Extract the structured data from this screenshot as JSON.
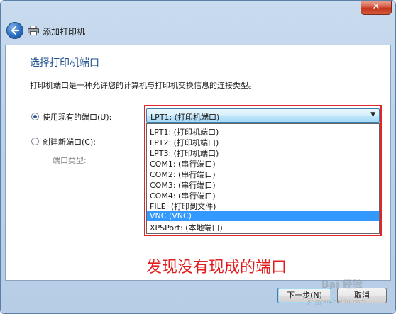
{
  "window": {
    "title": "添加打印机",
    "close_glyph": "✕"
  },
  "page": {
    "heading": "选择打印机端口",
    "description": "打印机端口是一种允许您的计算机与打印机交换信息的连接类型。"
  },
  "options": {
    "existing_label": "使用现有的端口(U):",
    "new_label": "创建新端口(C):",
    "port_type_label": "端口类型:"
  },
  "port_select": {
    "value": "LPT1: (打印机端口)",
    "items": [
      "LPT1: (打印机端口)",
      "LPT2: (打印机端口)",
      "LPT3: (打印机端口)",
      "COM1: (串行端口)",
      "COM2: (串行端口)",
      "COM3: (串行端口)",
      "COM4: (串行端口)",
      "FILE: (打印到文件)",
      "VNC (VNC)",
      "XPSPort: (本地端口)"
    ],
    "highlighted_item": "VNC (VNC)"
  },
  "annotation": {
    "text": "发现没有现成的端口",
    "color": "#e02020"
  },
  "buttons": {
    "next": "下一步(N)",
    "cancel": "取消"
  },
  "watermark": {
    "main": "Bai 经验",
    "sub": "jingyan.baidu.com"
  },
  "colors": {
    "heading": "#1e4f8d",
    "highlight": "#3399ff",
    "annotation_box": "#e0262b"
  }
}
